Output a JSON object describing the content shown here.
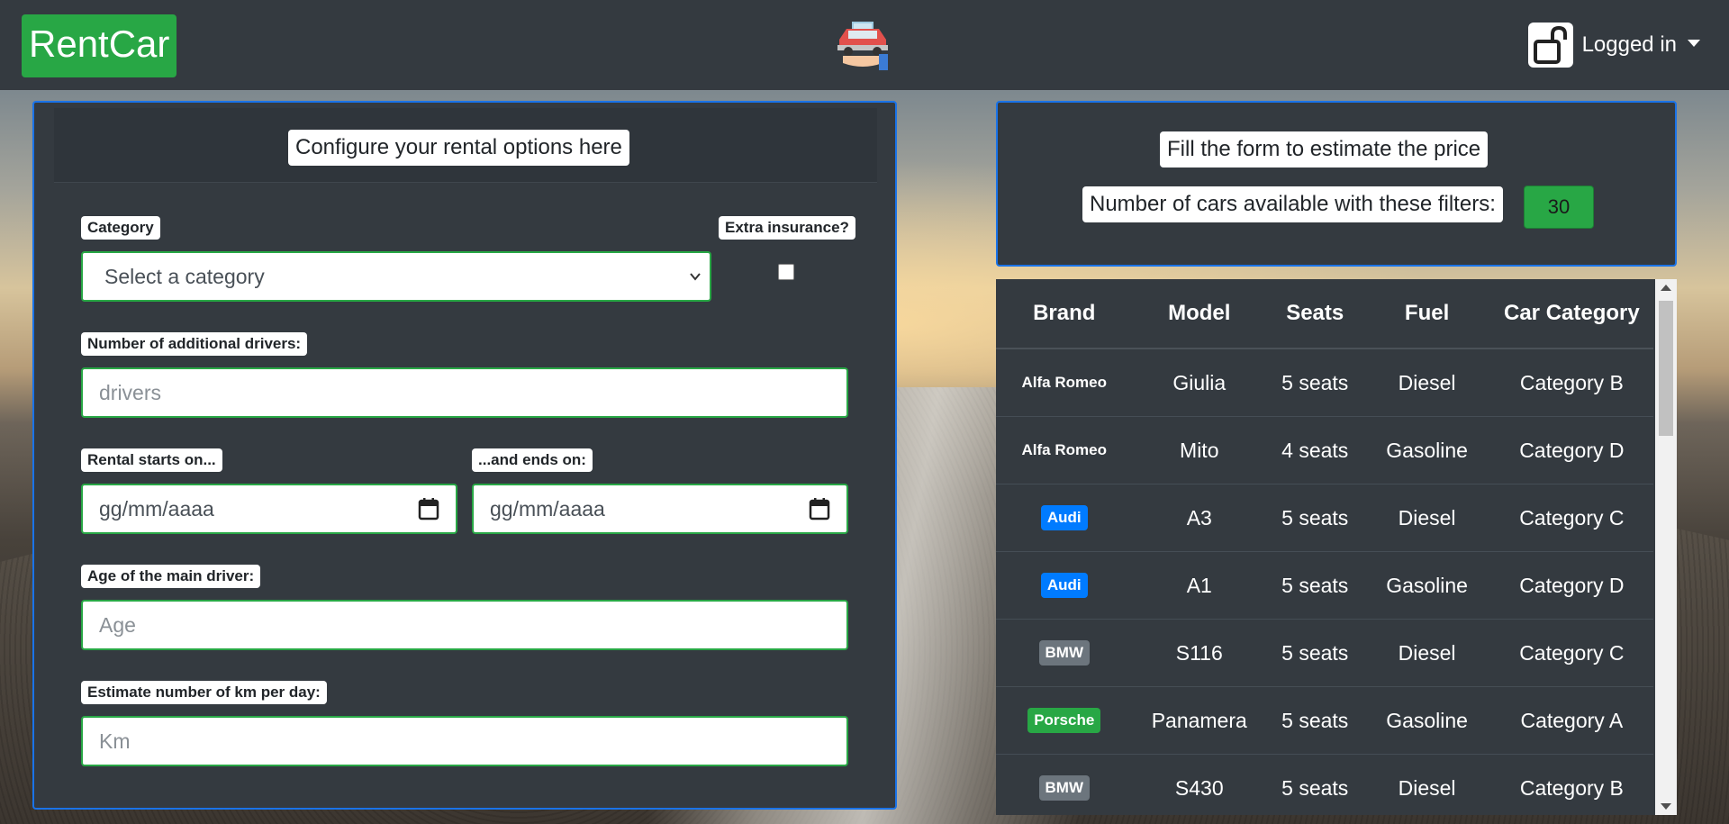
{
  "navbar": {
    "brand": "RentCar",
    "logo_icon": "car-on-hand-icon",
    "user_label": "Logged in"
  },
  "form": {
    "header": "Configure your rental options here",
    "category": {
      "label": "Category",
      "selected": "Select a category"
    },
    "extra_insurance": {
      "label": "Extra insurance?",
      "checked": false
    },
    "additional_drivers": {
      "label": "Number of additional drivers:",
      "placeholder": "drivers"
    },
    "start_date": {
      "label": "Rental starts on...",
      "placeholder": "gg/mm/aaaa"
    },
    "end_date": {
      "label": "...and ends on:",
      "placeholder": "gg/mm/aaaa"
    },
    "age": {
      "label": "Age of the main driver:",
      "placeholder": "Age"
    },
    "km": {
      "label": "Estimate number of km per day:",
      "placeholder": "Km"
    }
  },
  "summary": {
    "title": "Fill the form to estimate the price",
    "count_label": "Number of cars available with these filters:",
    "count": "30"
  },
  "table": {
    "headers": [
      "Brand",
      "Model",
      "Seats",
      "Fuel",
      "Car Category"
    ],
    "rows": [
      {
        "brand": "Alfa Romeo",
        "brand_style": "plain",
        "model": "Giulia",
        "seats": "5 seats",
        "fuel": "Diesel",
        "category": "Category B"
      },
      {
        "brand": "Alfa Romeo",
        "brand_style": "plain",
        "model": "Mito",
        "seats": "4 seats",
        "fuel": "Gasoline",
        "category": "Category D"
      },
      {
        "brand": "Audi",
        "brand_style": "#007bff",
        "model": "A3",
        "seats": "5 seats",
        "fuel": "Diesel",
        "category": "Category C"
      },
      {
        "brand": "Audi",
        "brand_style": "#007bff",
        "model": "A1",
        "seats": "5 seats",
        "fuel": "Gasoline",
        "category": "Category D"
      },
      {
        "brand": "BMW",
        "brand_style": "#6c757d",
        "model": "S116",
        "seats": "5 seats",
        "fuel": "Diesel",
        "category": "Category C"
      },
      {
        "brand": "Porsche",
        "brand_style": "#28a745",
        "model": "Panamera",
        "seats": "5 seats",
        "fuel": "Gasoline",
        "category": "Category A"
      },
      {
        "brand": "BMW",
        "brand_style": "#6c757d",
        "model": "S430",
        "seats": "5 seats",
        "fuel": "Diesel",
        "category": "Category B"
      }
    ]
  }
}
